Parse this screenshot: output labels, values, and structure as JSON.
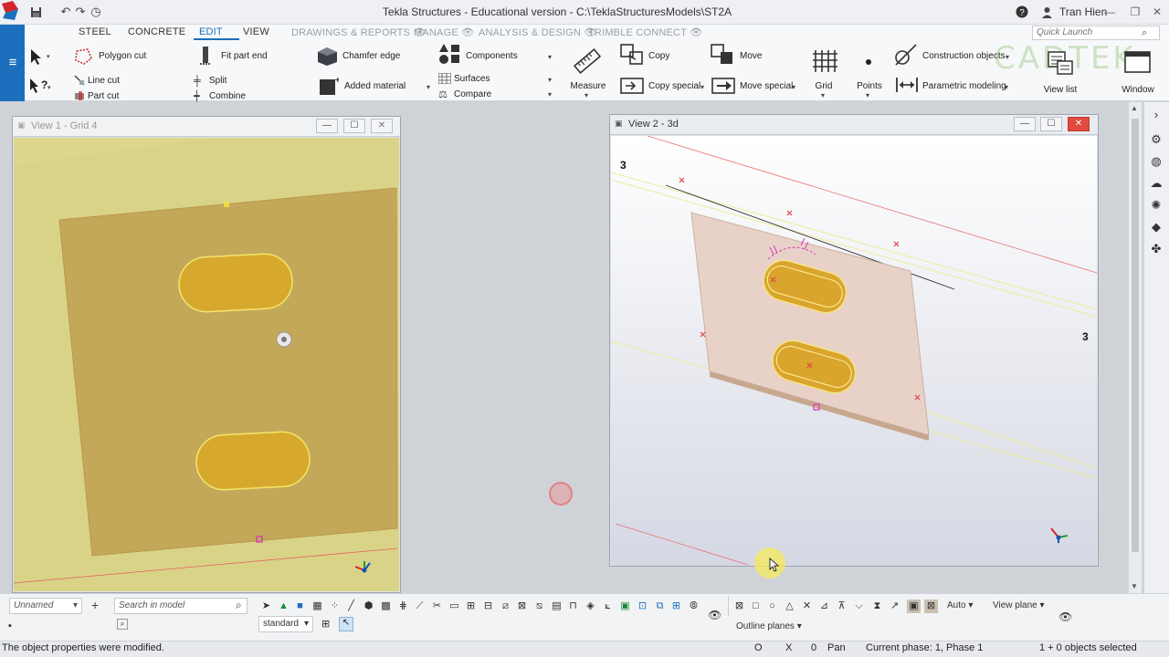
{
  "app": {
    "title": "Tekla Structures - Educational version - C:\\TeklaStructuresModels\\ST2A",
    "user": "Tran Hien",
    "quick_launch_placeholder": "Quick Launch",
    "watermark": "CADTEK"
  },
  "tabs": [
    {
      "label": "STEEL",
      "state": "normal"
    },
    {
      "label": "CONCRETE",
      "state": "normal"
    },
    {
      "label": "EDIT",
      "state": "active"
    },
    {
      "label": "VIEW",
      "state": "normal"
    },
    {
      "label": "DRAWINGS & REPORTS",
      "state": "dim"
    },
    {
      "label": "MANAGE",
      "state": "dim"
    },
    {
      "label": "ANALYSIS & DESIGN",
      "state": "dim"
    },
    {
      "label": "TRIMBLE CONNECT",
      "state": "dim"
    }
  ],
  "ribbon": {
    "polygon_cut": "Polygon cut",
    "line_cut": "Line cut",
    "part_cut": "Part cut",
    "fit_part_end": "Fit part end",
    "split": "Split",
    "combine": "Combine",
    "chamfer_edge": "Chamfer edge",
    "added_material": "Added material",
    "components": "Components",
    "surfaces": "Surfaces",
    "compare": "Compare",
    "measure": "Measure",
    "copy": "Copy",
    "copy_special": "Copy special",
    "move": "Move",
    "move_special": "Move special",
    "grid": "Grid",
    "points": "Points",
    "construction_objects": "Construction objects",
    "parametric_modeling": "Parametric modeling",
    "view_list": "View list",
    "window": "Window"
  },
  "views": {
    "view1_title": "View 1 - Grid 4",
    "view2_title": "View 2 - 3d",
    "grid_label_left": "3",
    "grid_label_right": "3"
  },
  "bottom": {
    "selection_filter": "Unnamed",
    "search_placeholder": "Search in model",
    "settings_combo": "standard",
    "snap_mode": "Auto",
    "view_plane": "View plane",
    "outline_planes": "Outline planes"
  },
  "status": {
    "message": "The object properties were modified.",
    "o_label": "O",
    "x_label": "X",
    "x_value": "0",
    "pan": "Pan",
    "phase": "Current phase: 1, Phase 1",
    "selection": "1 + 0 objects selected"
  },
  "colors": {
    "accent": "#1b6fbd",
    "close_red": "#e24a3f",
    "plate_left": "#c4a85a",
    "slot_fill": "#d6a92e",
    "view_bg_left": "#dcd68b"
  }
}
